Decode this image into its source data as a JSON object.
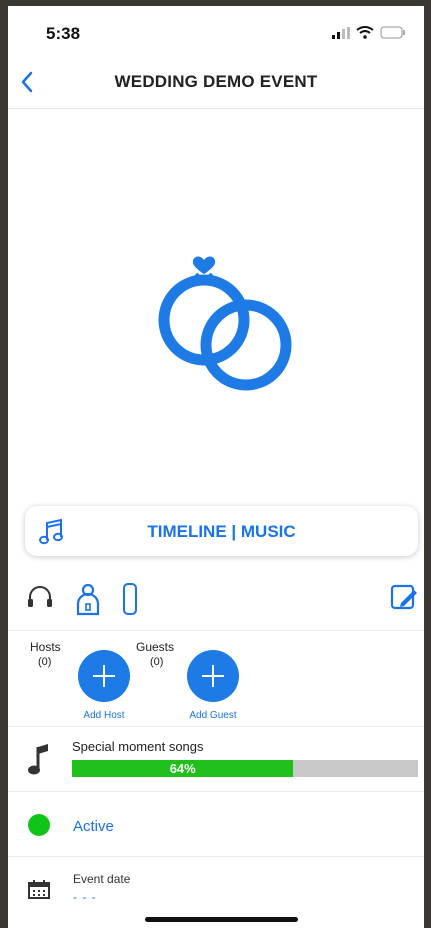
{
  "status_bar": {
    "time": "5:38"
  },
  "nav": {
    "title": "WEDDING DEMO EVENT"
  },
  "card": {
    "label": "TIMELINE | MUSIC"
  },
  "people": {
    "hosts_label": "Hosts",
    "hosts_count": "(0)",
    "guests_label": "Guests",
    "guests_count": "(0)",
    "add_host_label": "Add Host",
    "add_guest_label": "Add Guest"
  },
  "songs": {
    "title": "Special moment songs",
    "progress_text": "64%",
    "progress_fraction": 0.64
  },
  "status": {
    "label": "Active"
  },
  "event_date": {
    "title": "Event date",
    "value": "- - -"
  },
  "colors": {
    "accent": "#1a73e8",
    "progress": "#1fc01b",
    "active": "#11c418"
  }
}
